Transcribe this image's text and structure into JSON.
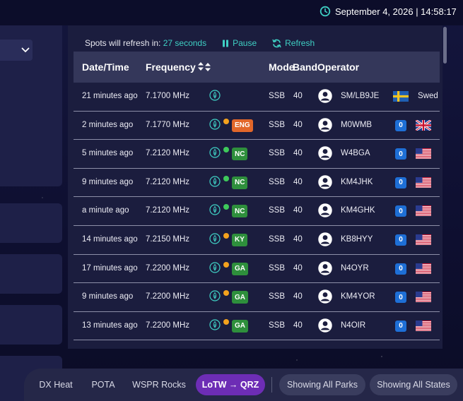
{
  "header": {
    "clock_text": "September 4, 2026 | 14:58:17"
  },
  "refresh": {
    "label": "Spots will refresh in:",
    "seconds": "27 seconds",
    "pause_label": "Pause",
    "refresh_label": "Refresh"
  },
  "table": {
    "columns": {
      "datetime": "Date/Time",
      "frequency": "Frequency",
      "mode": "Mode",
      "band": "Band",
      "operator": "Operator"
    },
    "rows": [
      {
        "time": "21 minutes ago",
        "freq": "7.1700 MHz",
        "dot": "",
        "state": "",
        "state_color": "",
        "mode": "SSB",
        "band": "40",
        "call": "SM/LB9JE",
        "qsl": "",
        "flag": "se",
        "country": "Swed"
      },
      {
        "time": "2 minutes ago",
        "freq": "7.1770 MHz",
        "dot": "#f4a21d",
        "state": "ENG",
        "state_color": "#e2672a",
        "mode": "SSB",
        "band": "40",
        "call": "M0WMB",
        "qsl": "0",
        "flag": "gb",
        "country": ""
      },
      {
        "time": "5 minutes ago",
        "freq": "7.2120 MHz",
        "dot": "#3ec95b",
        "state": "NC",
        "state_color": "#2e8f3c",
        "mode": "SSB",
        "band": "40",
        "call": "W4BGA",
        "qsl": "0",
        "flag": "us",
        "country": ""
      },
      {
        "time": "9 minutes ago",
        "freq": "7.2120 MHz",
        "dot": "#3ec95b",
        "state": "NC",
        "state_color": "#2e8f3c",
        "mode": "SSB",
        "band": "40",
        "call": "KM4JHK",
        "qsl": "0",
        "flag": "us",
        "country": ""
      },
      {
        "time": "a minute ago",
        "freq": "7.2120 MHz",
        "dot": "#3ec95b",
        "state": "NC",
        "state_color": "#2e8f3c",
        "mode": "SSB",
        "band": "40",
        "call": "KM4GHK",
        "qsl": "0",
        "flag": "us",
        "country": ""
      },
      {
        "time": "14 minutes ago",
        "freq": "7.2150 MHz",
        "dot": "#f4a21d",
        "state": "KY",
        "state_color": "#2e8f3c",
        "mode": "SSB",
        "band": "40",
        "call": "KB8HYY",
        "qsl": "0",
        "flag": "us",
        "country": ""
      },
      {
        "time": "17 minutes ago",
        "freq": "7.2200 MHz",
        "dot": "#f4a21d",
        "state": "GA",
        "state_color": "#2e8f3c",
        "mode": "SSB",
        "band": "40",
        "call": "N4OYR",
        "qsl": "0",
        "flag": "us",
        "country": ""
      },
      {
        "time": "9 minutes ago",
        "freq": "7.2200 MHz",
        "dot": "#f4a21d",
        "state": "GA",
        "state_color": "#2e8f3c",
        "mode": "SSB",
        "band": "40",
        "call": "KM4YOR",
        "qsl": "0",
        "flag": "us",
        "country": ""
      },
      {
        "time": "13 minutes ago",
        "freq": "7.2200 MHz",
        "dot": "#f4a21d",
        "state": "GA",
        "state_color": "#2e8f3c",
        "mode": "SSB",
        "band": "40",
        "call": "N4OIR",
        "qsl": "0",
        "flag": "us",
        "country": ""
      }
    ]
  },
  "bottom_nav": {
    "dx_heat": "DX Heat",
    "pota": "POTA",
    "wspr": "WSPR Rocks",
    "lotw": "LoTW → QRZ",
    "parks": "Showing All Parks",
    "states": "Showing All States"
  },
  "colors": {
    "accent_teal": "#3fd0c4",
    "active_pill": "#6d2db5",
    "header_row": "#34375a"
  }
}
